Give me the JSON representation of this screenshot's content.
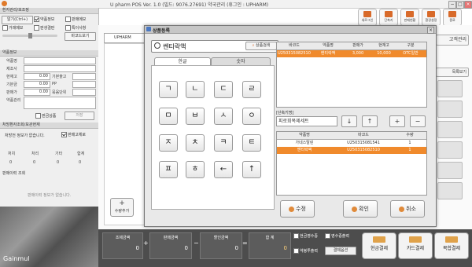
{
  "window": {
    "title": "U pharm POS Ver. 1.0 (빌드: 9076.27691) 약국관리 (휴그인 : UPHARM)",
    "min": "−",
    "max": "□",
    "close": "×"
  },
  "toolbar": [
    {
      "label": "새로그인"
    },
    {
      "label": "단축키"
    },
    {
      "label": "판매현황"
    },
    {
      "label": "환경설정"
    },
    {
      "label": "종료"
    }
  ],
  "left": {
    "header": "환자관리/보조정",
    "row1": [
      "알기(Ctrl+)",
      "약품정보",
      "판매메모"
    ],
    "row2": [
      "거래메모",
      "판생결판",
      "특이사항"
    ],
    "barcode_btn": "바코드보기",
    "drug_section": "약품정보",
    "drug_fields": [
      "약품명",
      "제조사",
      "판매가",
      "판매단가",
      "기본출고"
    ],
    "num_fields": [
      "현재고",
      "기본금"
    ],
    "field_values": [
      "0.00",
      "0.00",
      "0.00"
    ],
    "labels_right": [
      "기본출고",
      "PP",
      "묶음단위"
    ],
    "sub_labels": [
      "약품관리",
      "복약지도"
    ],
    "check_label": "판금상품",
    "check_btn": "저장",
    "prescription_hd": "처방환자조회/보관현재",
    "pres_text": "처방전 정보가 없습니다.",
    "pres_check": "판매고체로",
    "stats_hd": [
      "처치",
      "처리",
      "기타",
      "합계"
    ],
    "stats_values": [
      "0",
      "0",
      "0",
      "0"
    ],
    "history_hd": "판매이력 조회",
    "history_text": "판매이력 정보가 없습니다.",
    "photo_brand": "Gainmul"
  },
  "right": {
    "tab": "UPHARM",
    "side_buttons": [
      "고객관리",
      "목록보기"
    ],
    "add_button": "수량추가"
  },
  "dialog": {
    "title": "상품등록",
    "search_value": "쎈티락액",
    "search_button": "상품검색",
    "tabs": [
      "한글",
      "숫자"
    ],
    "keys": [
      "ㄱ",
      "ㄴ",
      "ㄷ",
      "ㄹ",
      "ㅁ",
      "ㅂ",
      "ㅅ",
      "ㅇ",
      "ㅈ",
      "ㅊ",
      "ㅋ",
      "ㅌ",
      "ㅍ",
      "ㅎ",
      "←",
      "↑"
    ],
    "grid1_headers": [
      "바코드",
      "약품명",
      "판매가",
      "현재고",
      "구분"
    ],
    "grid1_rows": [
      {
        "barcode": "U250315082510",
        "name": "쎈티락액",
        "price": "3,000",
        "stock": "10,000",
        "kind": "OTC일반"
      }
    ],
    "group_label": "[단축키명]",
    "group_value": "피로회복제세트",
    "arrow_buttons": [
      "↓",
      "↑",
      "+",
      "−"
    ],
    "grid2_headers": [
      "약품명",
      "바코드",
      "수량"
    ],
    "grid2_rows": [
      {
        "name": "가네스탈린",
        "barcode": "U250315081541",
        "qty": "1"
      },
      {
        "name": "쎈티락액",
        "barcode": "U250315082510",
        "qty": "1"
      }
    ],
    "actions": [
      "수정",
      "확인",
      "취소"
    ]
  },
  "bottom": {
    "totals": [
      {
        "label": "조제금액",
        "value": "0"
      },
      {
        "label": "판매금액",
        "value": "0"
      },
      {
        "label": "할인금액",
        "value": "0"
      },
      {
        "label": "합 계",
        "value": "0"
      }
    ],
    "ops": [
      "+",
      "−",
      "="
    ],
    "checks": [
      "현금영수증",
      "영수증출력",
      "약봉투출력",
      "결제옵션"
    ],
    "pay_buttons": [
      "현금결제",
      "카드결제",
      "복합결제"
    ]
  },
  "colors": {
    "accent": "#f08a2c",
    "bottom": "#4d4d4d"
  }
}
